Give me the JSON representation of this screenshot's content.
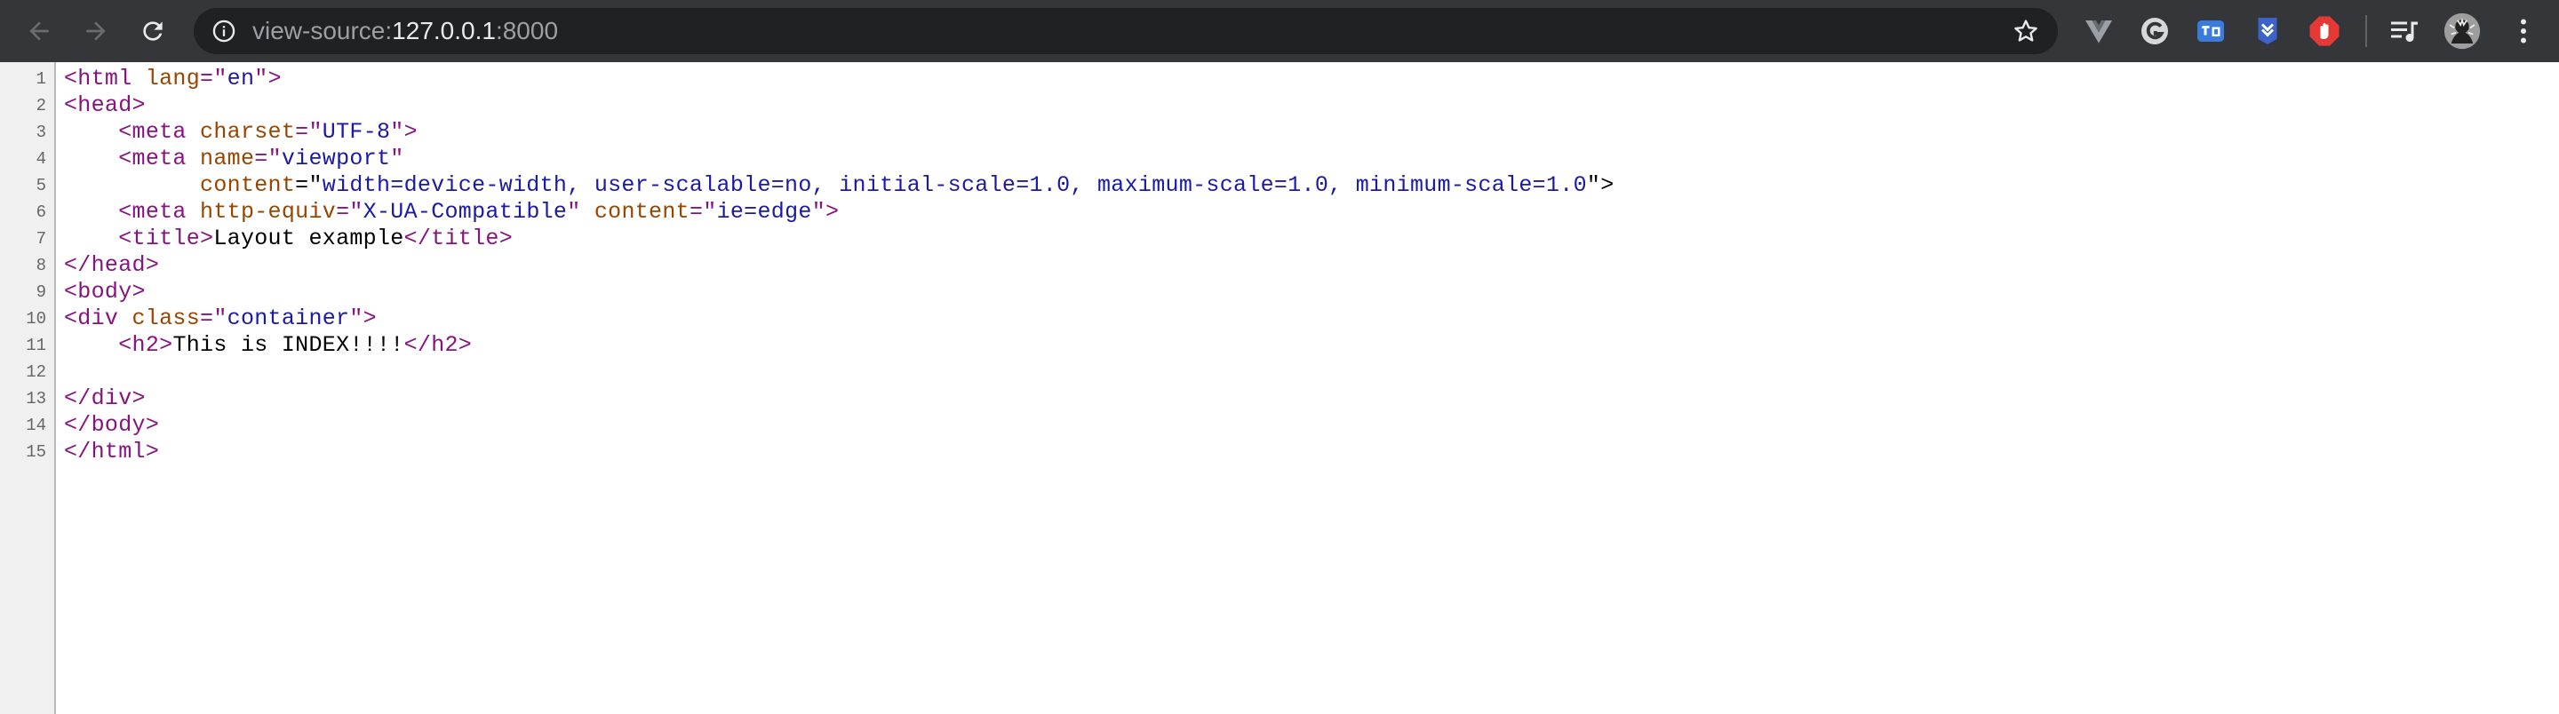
{
  "browser": {
    "url_scheme": "view-source:",
    "url_host": "127.0.0.1",
    "url_port": ":8000",
    "colors": {
      "toolbar_bg": "#35363a",
      "omnibox_bg": "#202124",
      "tag": "#881280",
      "attribute": "#994500",
      "value": "#1a1aa6"
    },
    "icons": [
      "back-arrow-icon",
      "forward-arrow-icon",
      "reload-icon",
      "info-icon",
      "star-icon",
      "vue-devtools-icon",
      "grammar-extension-icon",
      "translate-extension-icon",
      "save-extension-icon",
      "adblock-extension-icon",
      "media-queue-icon",
      "profile-avatar",
      "menu-kebab-icon"
    ]
  },
  "source": {
    "lines": [
      {
        "n": "1",
        "tokens": [
          {
            "t": "tag",
            "v": "<html "
          },
          {
            "t": "attr",
            "v": "lang"
          },
          {
            "t": "tag",
            "v": "=\""
          },
          {
            "t": "val",
            "v": "en"
          },
          {
            "t": "tag",
            "v": "\">"
          }
        ]
      },
      {
        "n": "2",
        "tokens": [
          {
            "t": "tag",
            "v": "<head>"
          }
        ]
      },
      {
        "n": "3",
        "tokens": [
          {
            "t": "txt",
            "v": "    "
          },
          {
            "t": "tag",
            "v": "<meta "
          },
          {
            "t": "attr",
            "v": "charset"
          },
          {
            "t": "tag",
            "v": "=\""
          },
          {
            "t": "val",
            "v": "UTF-8"
          },
          {
            "t": "tag",
            "v": "\">"
          }
        ]
      },
      {
        "n": "4",
        "tokens": [
          {
            "t": "txt",
            "v": "    "
          },
          {
            "t": "tag",
            "v": "<meta "
          },
          {
            "t": "attr",
            "v": "name"
          },
          {
            "t": "tag",
            "v": "=\""
          },
          {
            "t": "val",
            "v": "viewport"
          },
          {
            "t": "tag",
            "v": "\""
          }
        ]
      },
      {
        "n": "5",
        "tokens": [
          {
            "t": "txt",
            "v": "          "
          },
          {
            "t": "attr",
            "v": "content"
          },
          {
            "t": "txt",
            "v": "=\""
          },
          {
            "t": "val",
            "v": "width=device-width, user-scalable=no, initial-scale=1.0, maximum-scale=1.0, minimum-scale=1.0"
          },
          {
            "t": "txt",
            "v": "\">"
          }
        ]
      },
      {
        "n": "6",
        "tokens": [
          {
            "t": "txt",
            "v": "    "
          },
          {
            "t": "tag",
            "v": "<meta "
          },
          {
            "t": "attr",
            "v": "http-equiv"
          },
          {
            "t": "tag",
            "v": "=\""
          },
          {
            "t": "val",
            "v": "X-UA-Compatible"
          },
          {
            "t": "tag",
            "v": "\" "
          },
          {
            "t": "attr",
            "v": "content"
          },
          {
            "t": "tag",
            "v": "=\""
          },
          {
            "t": "val",
            "v": "ie=edge"
          },
          {
            "t": "tag",
            "v": "\">"
          }
        ]
      },
      {
        "n": "7",
        "tokens": [
          {
            "t": "txt",
            "v": "    "
          },
          {
            "t": "tag",
            "v": "<title>"
          },
          {
            "t": "txt",
            "v": "Layout example"
          },
          {
            "t": "tag",
            "v": "</title>"
          }
        ]
      },
      {
        "n": "8",
        "tokens": [
          {
            "t": "tag",
            "v": "</head>"
          }
        ]
      },
      {
        "n": "9",
        "tokens": [
          {
            "t": "tag",
            "v": "<body>"
          }
        ]
      },
      {
        "n": "10",
        "tokens": [
          {
            "t": "tag",
            "v": "<div "
          },
          {
            "t": "attr",
            "v": "class"
          },
          {
            "t": "tag",
            "v": "=\""
          },
          {
            "t": "val",
            "v": "container"
          },
          {
            "t": "tag",
            "v": "\">"
          }
        ]
      },
      {
        "n": "11",
        "tokens": [
          {
            "t": "txt",
            "v": "    "
          },
          {
            "t": "tag",
            "v": "<h2>"
          },
          {
            "t": "txt",
            "v": "This is INDEX!!!!"
          },
          {
            "t": "tag",
            "v": "</h2>"
          }
        ]
      },
      {
        "n": "12",
        "tokens": []
      },
      {
        "n": "13",
        "tokens": [
          {
            "t": "tag",
            "v": "</div>"
          }
        ]
      },
      {
        "n": "14",
        "tokens": [
          {
            "t": "tag",
            "v": "</body>"
          }
        ]
      },
      {
        "n": "15",
        "tokens": [
          {
            "t": "tag",
            "v": "</html>"
          }
        ]
      }
    ]
  }
}
